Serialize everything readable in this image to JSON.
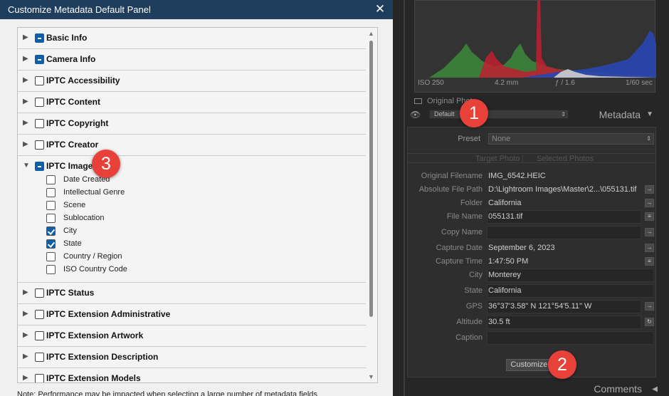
{
  "dialog": {
    "title": "Customize Metadata Default Panel",
    "close_glyph": "✕",
    "groups": [
      {
        "label": "Basic Info",
        "state": "mixed",
        "expanded": false
      },
      {
        "label": "Camera Info",
        "state": "mixed",
        "expanded": false
      },
      {
        "label": "IPTC Accessibility",
        "state": "unchecked",
        "expanded": false
      },
      {
        "label": "IPTC Content",
        "state": "unchecked",
        "expanded": false
      },
      {
        "label": "IPTC Copyright",
        "state": "unchecked",
        "expanded": false
      },
      {
        "label": "IPTC Creator",
        "state": "unchecked",
        "expanded": false
      },
      {
        "label": "IPTC Image",
        "state": "mixed",
        "expanded": true
      },
      {
        "label": "IPTC Status",
        "state": "unchecked",
        "expanded": false
      },
      {
        "label": "IPTC Extension Administrative",
        "state": "unchecked",
        "expanded": false
      },
      {
        "label": "IPTC Extension Artwork",
        "state": "unchecked",
        "expanded": false
      },
      {
        "label": "IPTC Extension Description",
        "state": "unchecked",
        "expanded": false
      },
      {
        "label": "IPTC Extension Models",
        "state": "unchecked",
        "expanded": false
      }
    ],
    "iptc_image_items": [
      {
        "label": "Date Created",
        "checked": false
      },
      {
        "label": "Intellectual Genre",
        "checked": false
      },
      {
        "label": "Scene",
        "checked": false
      },
      {
        "label": "Sublocation",
        "checked": false
      },
      {
        "label": "City",
        "checked": true
      },
      {
        "label": "State",
        "checked": true
      },
      {
        "label": "Country / Region",
        "checked": false
      },
      {
        "label": "ISO Country Code",
        "checked": false
      }
    ],
    "note": "Note: Performance may be impacted when selecting a large number of metadata fields"
  },
  "lightroom": {
    "histogram": {
      "iso": "ISO 250",
      "focal": "4.2 mm",
      "aperture": "ƒ / 1.6",
      "shutter": "1/60 sec"
    },
    "original_photo_label": "Original Photo",
    "metadata_header": {
      "preset_value": "Default",
      "title": "Metadata"
    },
    "preset": {
      "label": "Preset",
      "value": "None"
    },
    "tabs": {
      "target": "Target Photo",
      "selected": "Selected Photos"
    },
    "fields": [
      {
        "label": "Original Filename",
        "value": "IMG_6542.HEIC"
      },
      {
        "label": "Absolute File Path",
        "value": "D:\\Lightroom Images\\Master\\2...\\055131.tif"
      },
      {
        "label": "Folder",
        "value": "California"
      },
      {
        "label": "File Name",
        "value": "055131.tif"
      },
      {
        "label": "Copy Name",
        "value": ""
      },
      {
        "label": "Capture Date",
        "value": "September 6, 2023"
      },
      {
        "label": "Capture Time",
        "value": "1:47:50 PM"
      },
      {
        "label": "City",
        "value": "Monterey"
      },
      {
        "label": "State",
        "value": "California"
      },
      {
        "label": "GPS",
        "value": "36°37'3.58\" N 121°54'5.11\" W"
      },
      {
        "label": "Altitude",
        "value": "30.5 ft"
      },
      {
        "label": "Caption",
        "value": ""
      }
    ],
    "customize_label": "Customize...",
    "comments_label": "Comments"
  },
  "callouts": {
    "one": "1",
    "two": "2",
    "three": "3"
  },
  "colors": {
    "title_bar": "#1f3d5c",
    "checkbox_blue": "#0f5ea8",
    "callout_red": "#e8413a",
    "lr_bg": "#262626"
  }
}
